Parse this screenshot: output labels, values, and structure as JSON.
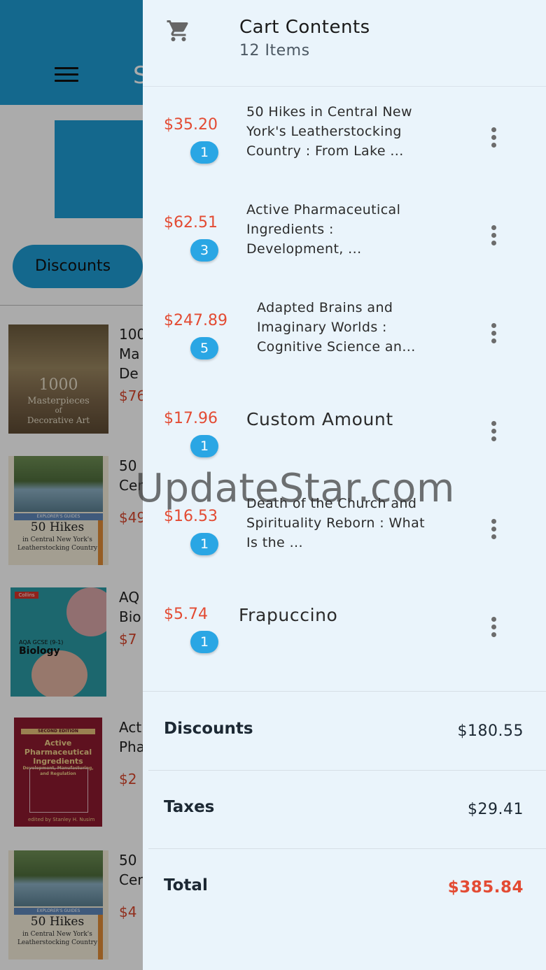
{
  "background": {
    "appbar_title": "S",
    "discounts_chip": "Discounts",
    "items": [
      {
        "title": "100",
        "title2": "Ma",
        "title3": "De",
        "price": "$76",
        "cover_text": [
          "1000",
          "Masterpieces",
          "of",
          "Decorative Art"
        ]
      },
      {
        "title": "50",
        "title2": "Cer",
        "price": "$49",
        "cover_text": [
          "EXPLORER'S GUIDES",
          "50 Hikes",
          "in Central New York's",
          "Leatherstocking Country"
        ]
      },
      {
        "title": "AQ",
        "title2": "Bio",
        "price": "$7",
        "cover_text": [
          "Collins",
          "AQA GCSE (9-1)",
          "Biology"
        ]
      },
      {
        "title": "Act",
        "title2": "Pha",
        "price": "$2",
        "cover_text": [
          "SECOND EDITION",
          "Active Pharmaceutical Ingredients",
          "Development, Manufacturing, and Regulation",
          "edited by",
          "Stanley H. Nusim"
        ]
      },
      {
        "title": "50",
        "title2": "Cer",
        "price": "$4",
        "cover_text": [
          "EXPLORER'S GUIDES",
          "50 Hikes",
          "in Central New York's",
          "Leatherstocking Country"
        ]
      }
    ]
  },
  "cart": {
    "icon": "shopping-cart-icon",
    "title": "Cart Contents",
    "subtitle": "12 Items",
    "items": [
      {
        "price": "$35.20",
        "qty": "1",
        "name": "50 Hikes in Central New York's Leatherstocking Country : From Lake ..."
      },
      {
        "price": "$62.51",
        "qty": "3",
        "name": "Active Pharmaceutical Ingredients : Development, ..."
      },
      {
        "price": "$247.89",
        "qty": "5",
        "name": "Adapted Brains and Imaginary Worlds : Cognitive Science an..."
      },
      {
        "price": "$17.96",
        "qty": "1",
        "name": "Custom Amount"
      },
      {
        "price": "$16.53",
        "qty": "1",
        "name": "Death of the Church and Spirituality Reborn : What Is the ..."
      },
      {
        "price": "$5.74",
        "qty": "1",
        "name": "Frapuccino"
      }
    ],
    "summary": {
      "discounts_label": "Discounts",
      "discounts_value": "$180.55",
      "taxes_label": "Taxes",
      "taxes_value": "$29.41",
      "total_label": "Total",
      "total_value": "$385.84"
    }
  },
  "watermark": "UpdateStar.com",
  "colors": {
    "accent": "#1f9bd3",
    "badge": "#2aa6e4",
    "price": "#e34b33",
    "drawer_bg": "#eaf4fb"
  }
}
